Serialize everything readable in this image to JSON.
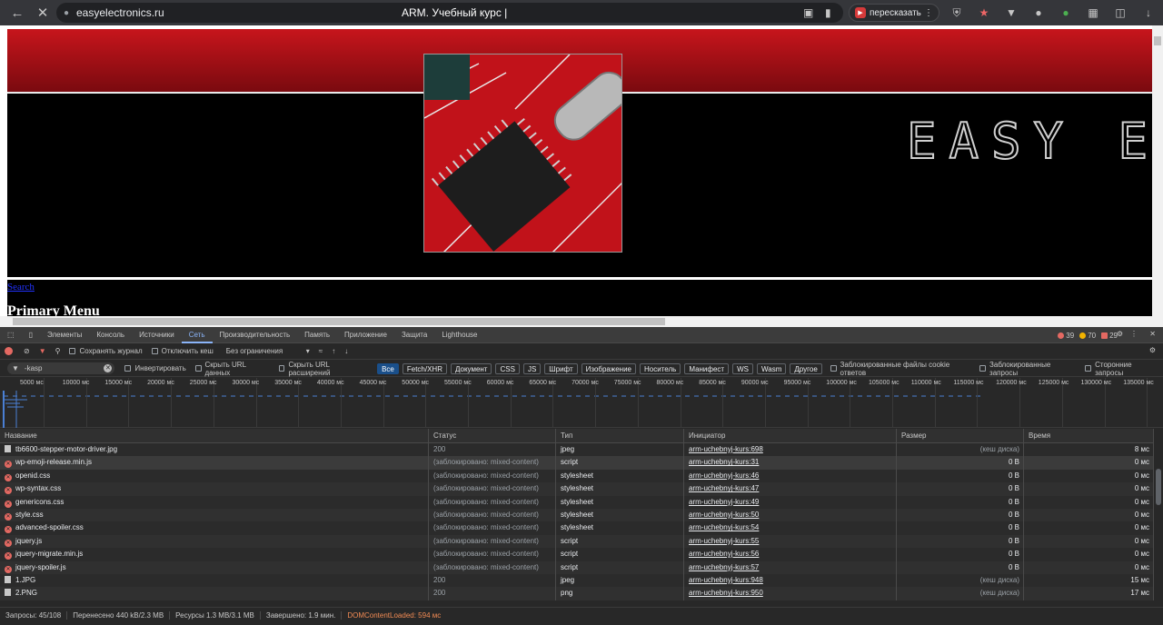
{
  "browser": {
    "url": "easyelectronics.ru",
    "tab_title": "ARM. Учебный курс |",
    "retell_label": "пересказать",
    "back_icon": "back-arrow-icon",
    "close_icon": "close-icon"
  },
  "page": {
    "search_link": "Search",
    "primary_menu": "Primary Menu",
    "banner_text": "EASY EL"
  },
  "devtools": {
    "tabs": [
      "Элементы",
      "Консоль",
      "Источники",
      "Сеть",
      "Производительность",
      "Память",
      "Приложение",
      "Защита",
      "Lighthouse"
    ],
    "active_tab": "Сеть",
    "errors": "39",
    "warnings": "70",
    "issues": "29",
    "toolbar": {
      "preserve_log": "Сохранять журнал",
      "disable_cache": "Отключить кеш",
      "throttle": "Без ограничения"
    },
    "filter": {
      "value": "-kasp",
      "invert": "Инвертировать",
      "hide_data_urls": "Скрыть URL данных",
      "hide_ext_urls": "Скрыть URL расширений",
      "types": [
        "Все",
        "Fetch/XHR",
        "Документ",
        "CSS",
        "JS",
        "Шрифт",
        "Изображение",
        "Носитель",
        "Манифест",
        "WS",
        "Wasm",
        "Другое"
      ],
      "blocked_cookies": "Заблокированные файлы cookie ответов",
      "blocked_requests": "Заблокированные запросы",
      "third_party": "Сторонние запросы"
    },
    "timeline_ticks": [
      "5000 мс",
      "10000 мс",
      "15000 мс",
      "20000 мс",
      "25000 мс",
      "30000 мс",
      "35000 мс",
      "40000 мс",
      "45000 мс",
      "50000 мс",
      "55000 мс",
      "60000 мс",
      "65000 мс",
      "70000 мс",
      "75000 мс",
      "80000 мс",
      "85000 мс",
      "90000 мс",
      "95000 мс",
      "100000 мс",
      "105000 мс",
      "110000 мс",
      "115000 мс",
      "120000 мс",
      "125000 мс",
      "130000 мс",
      "135000 мс"
    ],
    "columns": {
      "name": "Название",
      "status": "Статус",
      "type": "Тип",
      "initiator": "Инициатор",
      "size": "Размер",
      "time": "Время"
    },
    "rows": [
      {
        "name": "tb6600-stepper-motor-driver.jpg",
        "status": "200",
        "type": "jpeg",
        "initiator": "arm-uchebnyj-kurs:698",
        "size": "(кеш диска)",
        "time": "8 мс",
        "error": false
      },
      {
        "name": "wp-emoji-release.min.js",
        "status": "(заблокировано: mixed-content)",
        "type": "script",
        "initiator": "arm-uchebnyj-kurs:31",
        "size": "0 B",
        "time": "0 мс",
        "error": true
      },
      {
        "name": "openid.css",
        "status": "(заблокировано: mixed-content)",
        "type": "stylesheet",
        "initiator": "arm-uchebnyj-kurs:46",
        "size": "0 B",
        "time": "0 мс",
        "error": true
      },
      {
        "name": "wp-syntax.css",
        "status": "(заблокировано: mixed-content)",
        "type": "stylesheet",
        "initiator": "arm-uchebnyj-kurs:47",
        "size": "0 B",
        "time": "0 мс",
        "error": true
      },
      {
        "name": "genericons.css",
        "status": "(заблокировано: mixed-content)",
        "type": "stylesheet",
        "initiator": "arm-uchebnyj-kurs:49",
        "size": "0 B",
        "time": "0 мс",
        "error": true
      },
      {
        "name": "style.css",
        "status": "(заблокировано: mixed-content)",
        "type": "stylesheet",
        "initiator": "arm-uchebnyj-kurs:50",
        "size": "0 B",
        "time": "0 мс",
        "error": true
      },
      {
        "name": "advanced-spoiler.css",
        "status": "(заблокировано: mixed-content)",
        "type": "stylesheet",
        "initiator": "arm-uchebnyj-kurs:54",
        "size": "0 B",
        "time": "0 мс",
        "error": true
      },
      {
        "name": "jquery.js",
        "status": "(заблокировано: mixed-content)",
        "type": "script",
        "initiator": "arm-uchebnyj-kurs:55",
        "size": "0 B",
        "time": "0 мс",
        "error": true
      },
      {
        "name": "jquery-migrate.min.js",
        "status": "(заблокировано: mixed-content)",
        "type": "script",
        "initiator": "arm-uchebnyj-kurs:56",
        "size": "0 B",
        "time": "0 мс",
        "error": true
      },
      {
        "name": "jquery-spoiler.js",
        "status": "(заблокировано: mixed-content)",
        "type": "script",
        "initiator": "arm-uchebnyj-kurs:57",
        "size": "0 B",
        "time": "0 мс",
        "error": true
      },
      {
        "name": "1.JPG",
        "status": "200",
        "type": "jpeg",
        "initiator": "arm-uchebnyj-kurs:948",
        "size": "(кеш диска)",
        "time": "15 мс",
        "error": false
      },
      {
        "name": "2.PNG",
        "status": "200",
        "type": "png",
        "initiator": "arm-uchebnyj-kurs:950",
        "size": "(кеш диска)",
        "time": "17 мс",
        "error": false
      }
    ],
    "status": {
      "requests": "Запросы: 45/108",
      "transferred": "Перенесено 440 kB/2.3 MB",
      "resources": "Ресурсы 1.3 MB/3.1 MB",
      "finished": "Завершено: 1.9 мин.",
      "dcl": "DOMContentLoaded: 594 мс"
    }
  }
}
